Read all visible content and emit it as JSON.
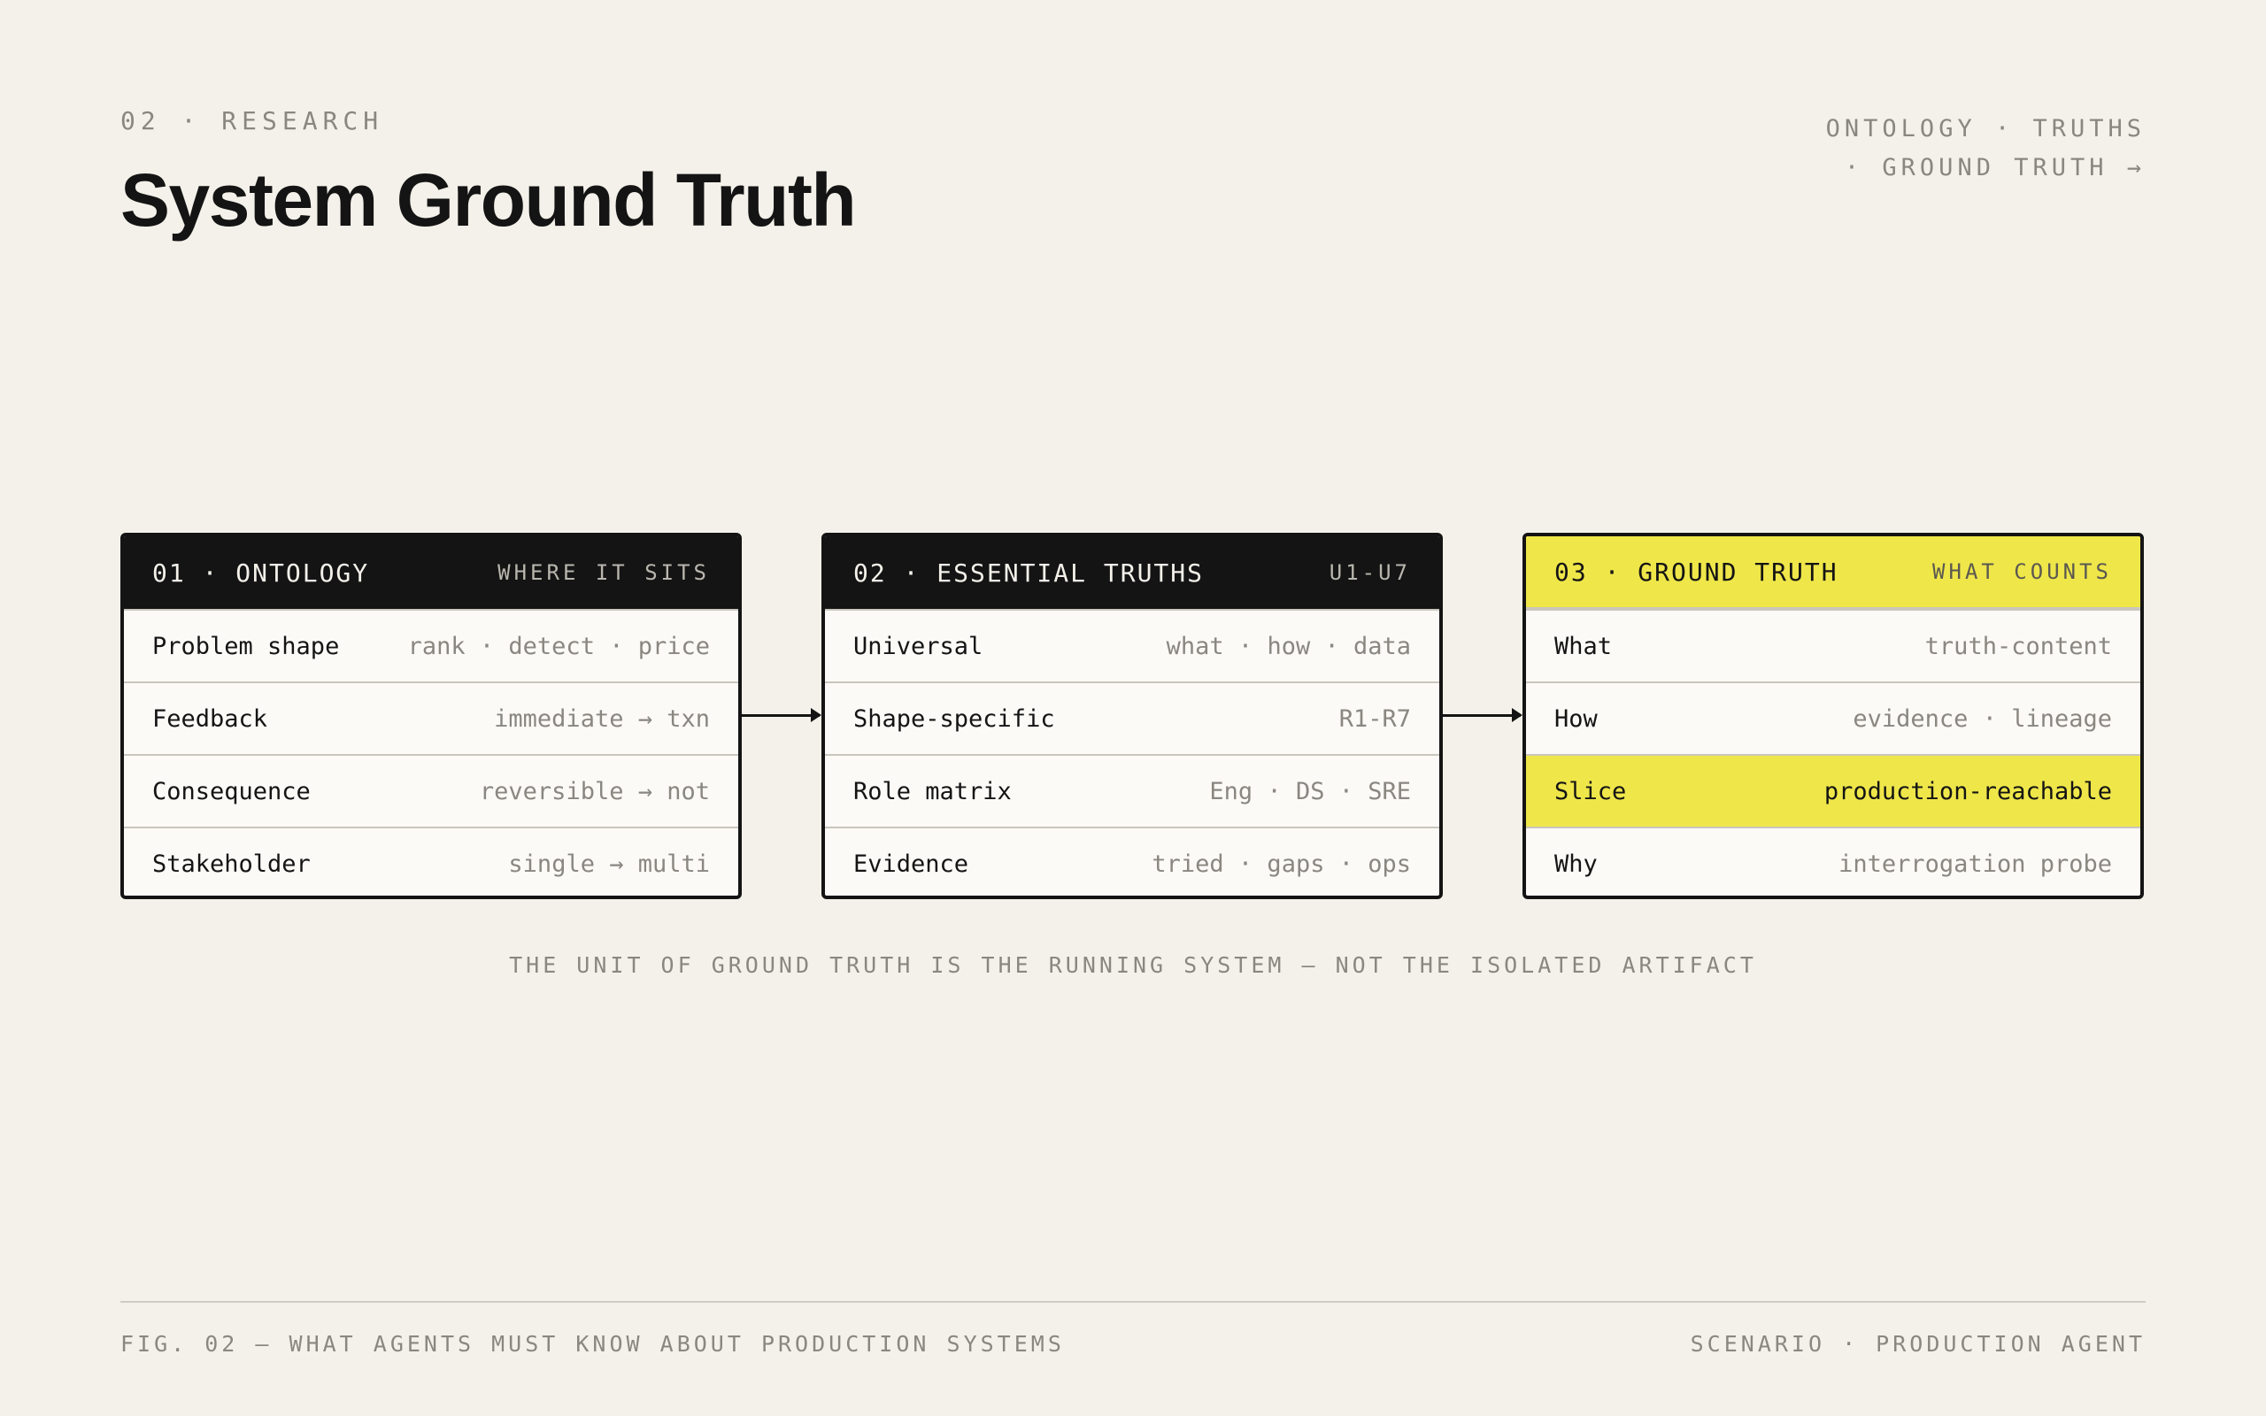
{
  "header": {
    "eyebrow": "02 · RESEARCH",
    "title": "System Ground Truth",
    "breadcrumb_line1": "ONTOLOGY · TRUTHS",
    "breadcrumb_line2": "· GROUND TRUTH →"
  },
  "cards": [
    {
      "title": "01 · ONTOLOGY",
      "tag": "WHERE IT SITS",
      "rows": [
        {
          "key": "Problem shape",
          "value": "rank · detect · price"
        },
        {
          "key": "Feedback",
          "value": "immediate → txn"
        },
        {
          "key": "Consequence",
          "value": "reversible → not"
        },
        {
          "key": "Stakeholder",
          "value": "single → multi"
        }
      ]
    },
    {
      "title": "02 · ESSENTIAL TRUTHS",
      "tag": "U1-U7",
      "rows": [
        {
          "key": "Universal",
          "value": "what · how · data"
        },
        {
          "key": "Shape-specific",
          "value": "R1-R7"
        },
        {
          "key": "Role matrix",
          "value": "Eng · DS · SRE"
        },
        {
          "key": "Evidence",
          "value": "tried · gaps · ops"
        }
      ]
    },
    {
      "title": "03 · GROUND TRUTH",
      "tag": "WHAT COUNTS",
      "rows": [
        {
          "key": "What",
          "value": "truth-content"
        },
        {
          "key": "How",
          "value": "evidence · lineage"
        },
        {
          "key": "Slice",
          "value": "production-reachable"
        },
        {
          "key": "Why",
          "value": "interrogation probe"
        }
      ]
    }
  ],
  "caption": "THE UNIT OF GROUND TRUTH IS THE RUNNING SYSTEM — NOT THE ISOLATED ARTIFACT",
  "footer": {
    "left": "FIG. 02 — WHAT AGENTS MUST KNOW ABOUT PRODUCTION SYSTEMS",
    "right": "SCENARIO · PRODUCTION AGENT"
  },
  "colors": {
    "background": "#f4f1ea",
    "ink": "#141414",
    "highlight": "#efe64a",
    "muted": "#8a8781"
  }
}
